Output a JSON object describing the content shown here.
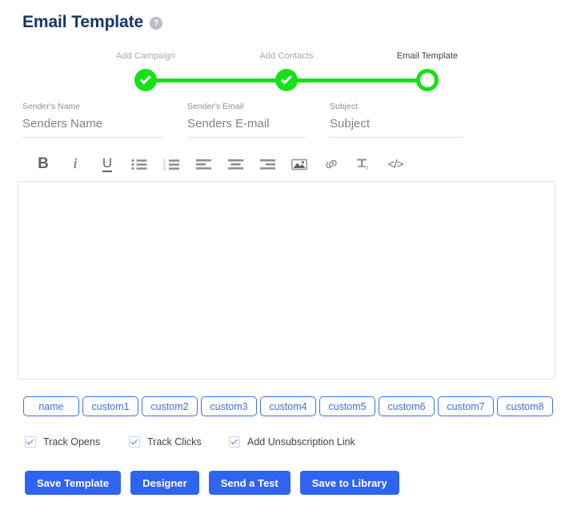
{
  "header": {
    "title": "Email Template",
    "help_icon": "help-circle-icon",
    "help_glyph": "?"
  },
  "stepper": {
    "steps": [
      {
        "label": "Add Campaign",
        "state": "completed",
        "icon": "check-icon"
      },
      {
        "label": "Add Contacts",
        "state": "completed",
        "icon": "check-icon"
      },
      {
        "label": "Email Template",
        "state": "current",
        "icon": ""
      }
    ],
    "accent_color": "#16e016",
    "completed_label_color": "#a6a9ae",
    "current_label_color": "#3a3f4a"
  },
  "form": {
    "fields": [
      {
        "label": "Sender's Name",
        "value": "",
        "placeholder": "Senders Name"
      },
      {
        "label": "Sender's Email",
        "value": "",
        "placeholder": "Senders E-mail"
      },
      {
        "label": "Subject",
        "value": "",
        "placeholder": "Subject"
      }
    ]
  },
  "editor": {
    "toolbar": [
      {
        "name": "bold-icon",
        "label": "B"
      },
      {
        "name": "italic-icon",
        "label": "i"
      },
      {
        "name": "underline-icon",
        "label": "U"
      },
      {
        "name": "unordered-list-icon",
        "label": ""
      },
      {
        "name": "ordered-list-icon",
        "label": ""
      },
      {
        "name": "align-left-icon",
        "label": ""
      },
      {
        "name": "align-center-icon",
        "label": ""
      },
      {
        "name": "align-right-icon",
        "label": ""
      },
      {
        "name": "insert-image-icon",
        "label": ""
      },
      {
        "name": "insert-link-icon",
        "label": ""
      },
      {
        "name": "remove-format-icon",
        "label": ""
      },
      {
        "name": "source-code-icon",
        "label": "</>"
      }
    ],
    "content": "",
    "border_color": "#dde1e9"
  },
  "variables": {
    "chips": [
      "name",
      "custom1",
      "custom2",
      "custom3",
      "custom4",
      "custom5",
      "custom6",
      "custom7",
      "custom8"
    ],
    "color": "#3f6ef5"
  },
  "options": [
    {
      "label": "Track Opens",
      "checked": true
    },
    {
      "label": "Track Clicks",
      "checked": true
    },
    {
      "label": "Add Unsubscription Link",
      "checked": true
    }
  ],
  "actions": [
    {
      "label": "Save Template"
    },
    {
      "label": "Designer"
    },
    {
      "label": "Send a Test"
    },
    {
      "label": "Save to Library"
    }
  ],
  "colors": {
    "primary_button": "#2f64f0",
    "title": "#16366b",
    "page_background": "#ffffff"
  }
}
